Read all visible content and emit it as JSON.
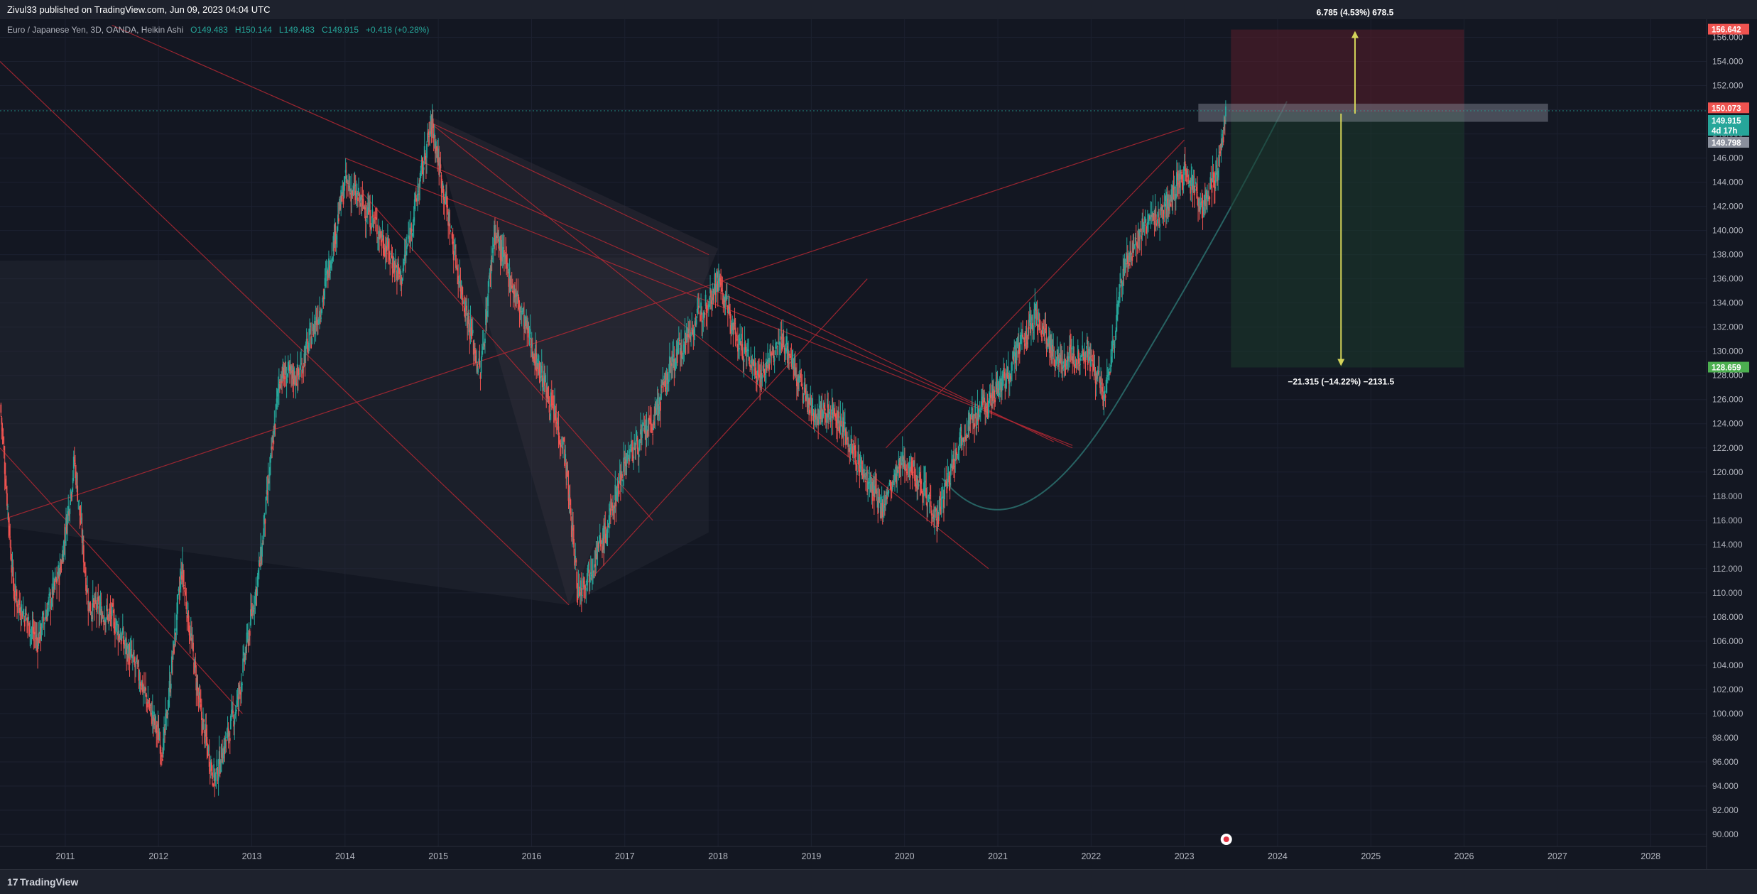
{
  "header": {
    "published": "Zivul33 published on TradingView.com, Jun 09, 2023 04:04 UTC"
  },
  "legend": {
    "symbol": "Euro / Japanese Yen, 3D, OANDA, Heikin Ashi",
    "open": "O149.483",
    "high": "H150.144",
    "low": "L149.483",
    "close": "C149.915",
    "change": "+0.418 (+0.28%)"
  },
  "axis": {
    "currency": "JPY"
  },
  "price_tags": {
    "stop": "156.642",
    "high": "150.073",
    "last": "149.915",
    "countdown": "4d 17h",
    "entry": "149.798",
    "target": "128.659"
  },
  "position_labels": {
    "upper": "6.785 (4.53%) 678.5",
    "lower": "−21.315 (−14.22%) −2131.5"
  },
  "footer": {
    "brand": "TradingView"
  },
  "colors": {
    "background": "#131722",
    "up": "#26a69a",
    "down": "#ef5350",
    "trendline": "#b22833",
    "arrow": "#d4d45a",
    "stop_zone": "#5a1e2a",
    "target_zone": "#1c3a2c",
    "curve": "#2a6b6a"
  },
  "chart_data": {
    "type": "candlestick",
    "style": "Heikin Ashi",
    "ylim": [
      89,
      157.5
    ],
    "y_ticks": [
      90,
      92,
      94,
      96,
      98,
      100,
      102,
      104,
      106,
      108,
      110,
      112,
      114,
      116,
      118,
      120,
      122,
      124,
      126,
      128,
      130,
      132,
      134,
      136,
      138,
      140,
      142,
      144,
      146,
      148,
      150,
      152,
      154,
      156
    ],
    "x_ticks": [
      "2011",
      "2012",
      "2013",
      "2014",
      "2015",
      "2016",
      "2017",
      "2018",
      "2019",
      "2020",
      "2021",
      "2022",
      "2023",
      "2024",
      "2025",
      "2026",
      "2027",
      "2028"
    ],
    "xlim": [
      2010.3,
      2028.6
    ],
    "price_path": [
      [
        2010.3,
        126
      ],
      [
        2010.45,
        110
      ],
      [
        2010.7,
        106
      ],
      [
        2010.95,
        112
      ],
      [
        2011.1,
        121
      ],
      [
        2011.25,
        109
      ],
      [
        2011.5,
        108
      ],
      [
        2011.8,
        103
      ],
      [
        2012.05,
        97
      ],
      [
        2012.25,
        112
      ],
      [
        2012.45,
        100
      ],
      [
        2012.6,
        94.5
      ],
      [
        2012.85,
        101
      ],
      [
        2013.1,
        113
      ],
      [
        2013.3,
        128
      ],
      [
        2013.5,
        128
      ],
      [
        2013.75,
        134
      ],
      [
        2014.0,
        144
      ],
      [
        2014.3,
        141
      ],
      [
        2014.6,
        136
      ],
      [
        2014.93,
        149
      ],
      [
        2015.2,
        137
      ],
      [
        2015.45,
        128
      ],
      [
        2015.6,
        140
      ],
      [
        2015.9,
        133
      ],
      [
        2016.15,
        127
      ],
      [
        2016.35,
        122
      ],
      [
        2016.5,
        110
      ],
      [
        2016.8,
        115
      ],
      [
        2017.0,
        121
      ],
      [
        2017.3,
        124
      ],
      [
        2017.5,
        129
      ],
      [
        2017.8,
        133
      ],
      [
        2018.0,
        136
      ],
      [
        2018.2,
        131
      ],
      [
        2018.45,
        128
      ],
      [
        2018.7,
        131
      ],
      [
        2019.0,
        125
      ],
      [
        2019.25,
        125
      ],
      [
        2019.55,
        120
      ],
      [
        2019.75,
        117
      ],
      [
        2020.0,
        121
      ],
      [
        2020.2,
        119
      ],
      [
        2020.35,
        116
      ],
      [
        2020.6,
        123
      ],
      [
        2020.85,
        125.5
      ],
      [
        2021.1,
        128
      ],
      [
        2021.4,
        133
      ],
      [
        2021.65,
        129
      ],
      [
        2021.95,
        130
      ],
      [
        2022.15,
        126
      ],
      [
        2022.35,
        137
      ],
      [
        2022.55,
        140
      ],
      [
        2022.8,
        142
      ],
      [
        2023.0,
        145
      ],
      [
        2023.2,
        142
      ],
      [
        2023.35,
        145
      ],
      [
        2023.45,
        149.9
      ]
    ],
    "position": {
      "type": "short",
      "entry": 149.798,
      "stop": 156.642,
      "target": 128.659,
      "x_start": 2023.5,
      "x_end": 2026.0
    },
    "horizontal_zone": {
      "low": 149.0,
      "high": 150.5,
      "x_start": 2023.15,
      "x_end": 2026.9
    },
    "last_price_line": 149.915
  }
}
